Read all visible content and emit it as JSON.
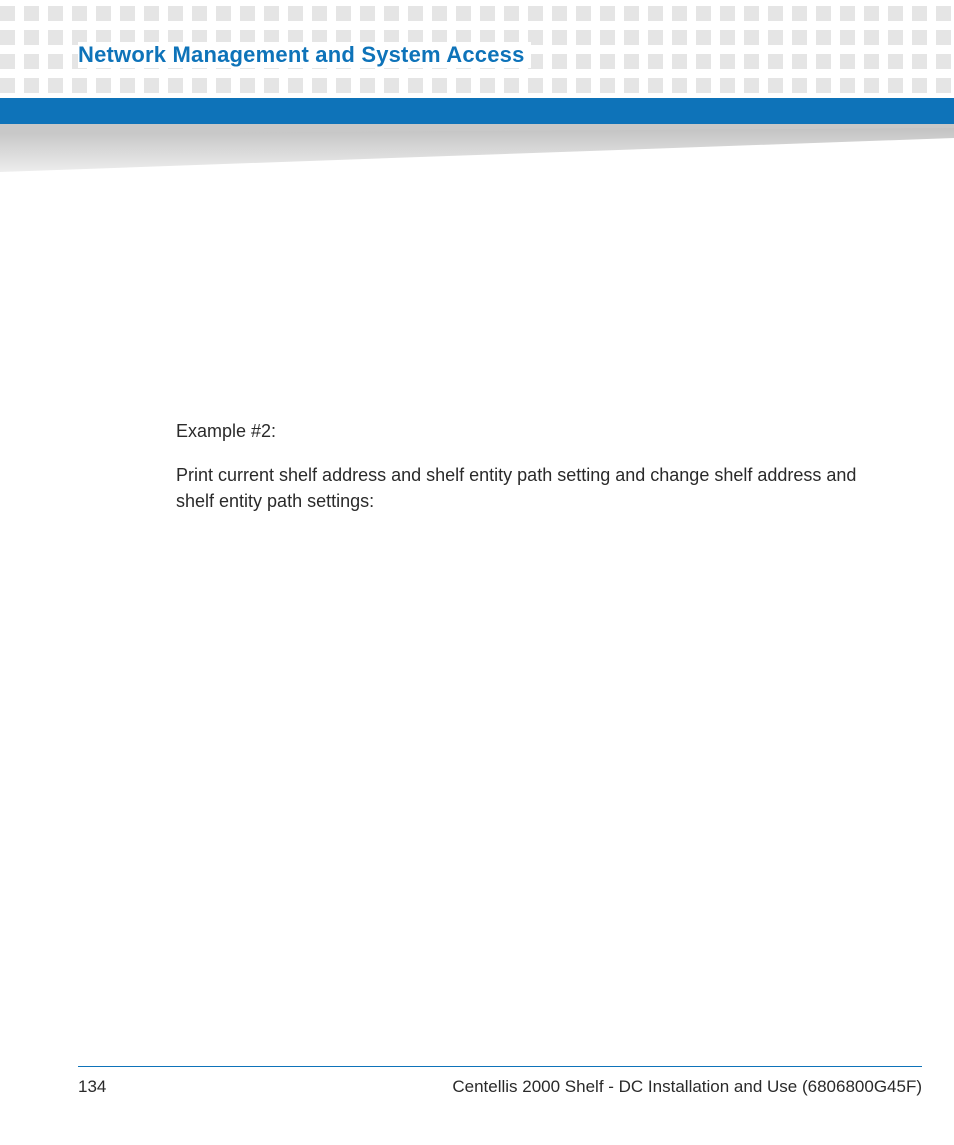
{
  "header": {
    "title": "Network Management and System Access"
  },
  "content": {
    "example_label": "Example #2:",
    "paragraph": "Print current shelf address and shelf entity path setting and change shelf address and shelf entity path settings:"
  },
  "footer": {
    "page_number": "134",
    "document_title": "Centellis 2000 Shelf - DC Installation and Use (6806800G45F)"
  }
}
